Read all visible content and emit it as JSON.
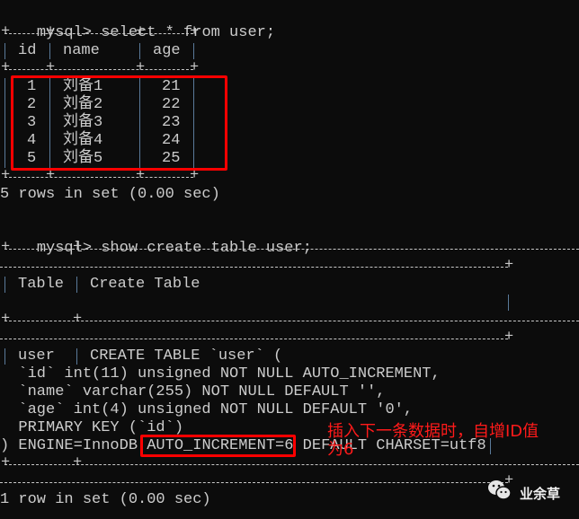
{
  "terminal": {
    "prompt": "mysql>",
    "command1": "select * from user;",
    "table1": {
      "headers": [
        "id",
        "name",
        "age"
      ],
      "rows": [
        {
          "id": "1",
          "name": "刘备1",
          "age": "21"
        },
        {
          "id": "2",
          "name": "刘备2",
          "age": "22"
        },
        {
          "id": "3",
          "name": "刘备3",
          "age": "23"
        },
        {
          "id": "4",
          "name": "刘备4",
          "age": "24"
        },
        {
          "id": "5",
          "name": "刘备5",
          "age": "25"
        }
      ]
    },
    "result1": "5 rows in set (0.00 sec)",
    "command2": "show create table user;",
    "table2": {
      "headers": [
        "Table",
        "Create Table"
      ],
      "table_name": "user",
      "create_lines": [
        "CREATE TABLE `user` (",
        "  `id` int(11) unsigned NOT NULL AUTO_INCREMENT,",
        "  `name` varchar(255) NOT NULL DEFAULT '',",
        "  `age` int(4) unsigned NOT NULL DEFAULT '0',",
        "  PRIMARY KEY (`id`)",
        ") ENGINE=InnoDB ",
        "AUTO_INCREMENT=6",
        " DEFAULT CHARSET=utf8"
      ]
    },
    "result2": "1 row in set (0.00 sec)"
  },
  "annotation": {
    "line1": "插入下一条数据时，自增ID值",
    "line2": "为6",
    "color": "#ff0000"
  },
  "watermark": {
    "icon": "wechat-icon",
    "text": "业余草"
  }
}
